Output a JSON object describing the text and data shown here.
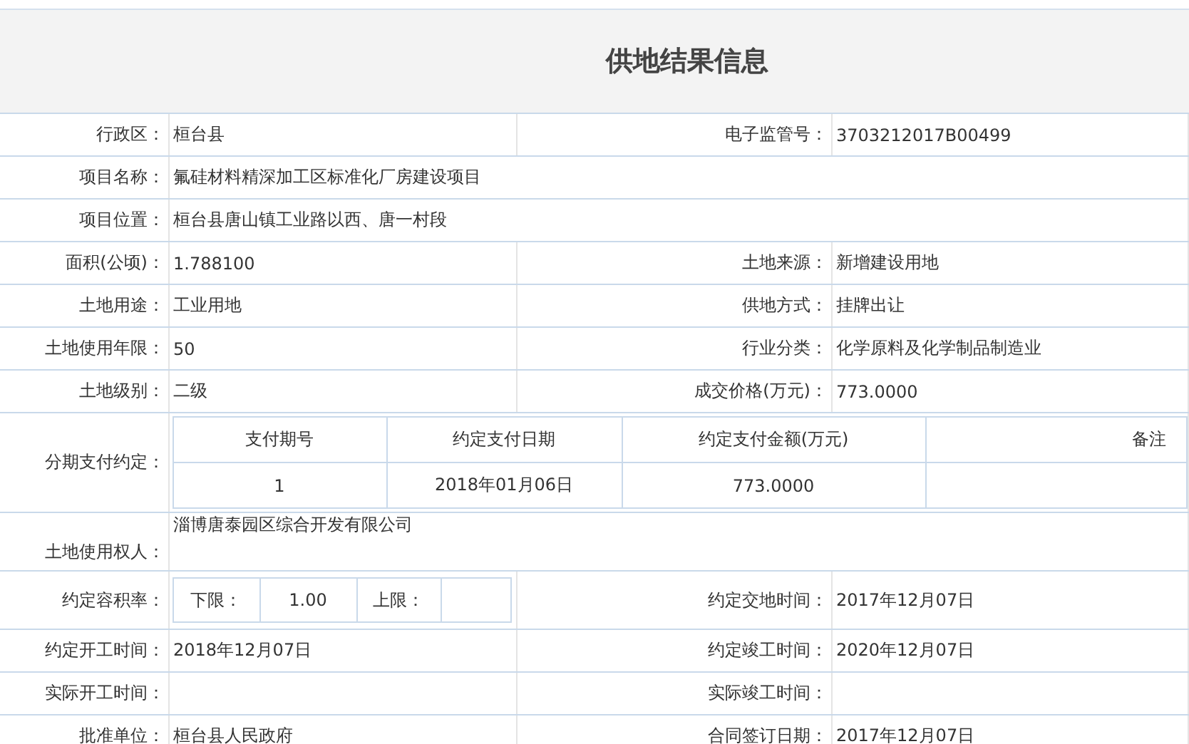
{
  "title": "供地结果信息",
  "rows": [
    {
      "kind": "pair",
      "label": "行政区：",
      "value": "桓台县",
      "label2": "电子监管号：",
      "value2": "3703212017B00499"
    },
    {
      "kind": "full",
      "label": "项目名称：",
      "value": "氟硅材料精深加工区标准化厂房建设项目"
    },
    {
      "kind": "full",
      "label": "项目位置：",
      "value": "桓台县唐山镇工业路以西、唐一村段"
    },
    {
      "kind": "pair",
      "label": "面积(公顷)：",
      "value": "1.788100",
      "label2": "土地来源：",
      "value2": "新增建设用地"
    },
    {
      "kind": "pair",
      "label": "土地用途：",
      "value": "工业用地",
      "label2": "供地方式：",
      "value2": "挂牌出让"
    },
    {
      "kind": "pair",
      "label": "土地使用年限：",
      "value": "50",
      "label2": "行业分类：",
      "value2": "化学原料及化学制品制造业"
    },
    {
      "kind": "pair",
      "label": "土地级别：",
      "value": "二级",
      "label2": "成交价格(万元)：",
      "value2": "773.0000"
    },
    {
      "kind": "payments",
      "label": "分期支付约定：",
      "columns": [
        "支付期号",
        "约定支付日期",
        "约定支付金额(万元)",
        "备注"
      ],
      "rows": [
        [
          "1",
          "2018年01月06日",
          "773.0000",
          ""
        ]
      ]
    },
    {
      "kind": "owner",
      "label": "土地使用权人：",
      "value": "淄博唐泰园区综合开发有限公司"
    },
    {
      "kind": "ratio",
      "label": "约定容积率：",
      "lower_label": "下限：",
      "lower": "1.00",
      "upper_label": "上限：",
      "label2": "约定交地时间：",
      "value2": "2017年12月07日"
    },
    {
      "kind": "pair",
      "label": "约定开工时间：",
      "value": "2018年12月07日",
      "label2": "约定竣工时间：",
      "value2": "2020年12月07日"
    },
    {
      "kind": "pair",
      "label": "实际开工时间：",
      "value": "",
      "label2": "实际竣工时间：",
      "value2": ""
    },
    {
      "kind": "pair",
      "label": "批准单位：",
      "value": "桓台县人民政府",
      "label2": "合同签订日期：",
      "value2": "2017年12月07日"
    }
  ]
}
